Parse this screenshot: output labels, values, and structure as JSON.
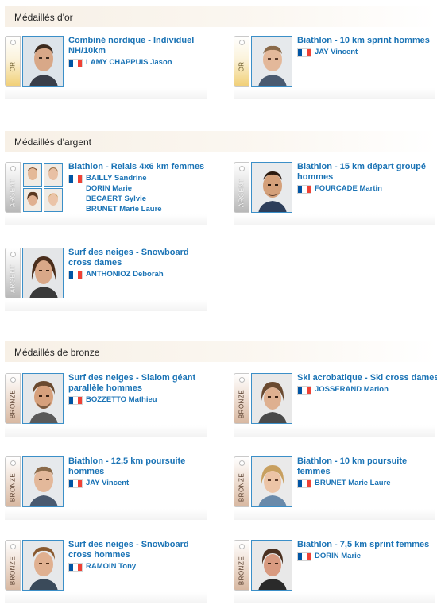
{
  "sections": {
    "gold": {
      "title": "Médaillés d'or",
      "badge": "OR"
    },
    "silver": {
      "title": "Médaillés d'argent",
      "badge": "ARGENT"
    },
    "bronze": {
      "title": "Médaillés de bronze",
      "badge": "BRONZE"
    }
  },
  "colors": {
    "link": "#1a73b5",
    "header_bg": "#f7f0e6",
    "photo_border": "#3b8fc8",
    "flag_blue": "#0055a4",
    "flag_white": "#ffffff",
    "flag_red": "#ef4135"
  },
  "flag_icon": "france-flag-icon",
  "medals": {
    "gold": [
      {
        "event": "Combiné nordique - Individuel NH/10km",
        "athletes": [
          "LAMY CHAPPUIS Jason"
        ]
      },
      {
        "event": "Biathlon - 10 km sprint hommes",
        "athletes": [
          "JAY Vincent"
        ]
      }
    ],
    "silver": [
      {
        "event": "Biathlon - Relais 4x6 km femmes",
        "athletes": [
          "BAILLY Sandrine",
          "DORIN Marie",
          "BECAERT Sylvie",
          "BRUNET Marie Laure"
        ]
      },
      {
        "event": "Biathlon - 15 km départ groupé hommes",
        "athletes": [
          "FOURCADE Martin"
        ]
      },
      {
        "event": "Surf des neiges - Snowboard cross dames",
        "athletes": [
          "ANTHONIOZ Deborah"
        ]
      }
    ],
    "bronze": [
      {
        "event": "Surf des neiges - Slalom géant parallèle hommes",
        "athletes": [
          "BOZZETTO Mathieu"
        ]
      },
      {
        "event": "Ski acrobatique - Ski cross dames",
        "athletes": [
          "JOSSERAND Marion"
        ]
      },
      {
        "event": "Biathlon - 12,5 km poursuite hommes",
        "athletes": [
          "JAY Vincent"
        ]
      },
      {
        "event": "Biathlon - 10 km poursuite femmes",
        "athletes": [
          "BRUNET Marie Laure"
        ]
      },
      {
        "event": "Surf des neiges - Snowboard cross hommes",
        "athletes": [
          "RAMOIN Tony"
        ]
      },
      {
        "event": "Biathlon - 7,5 km sprint femmes",
        "athletes": [
          "DORIN Marie"
        ]
      }
    ]
  }
}
